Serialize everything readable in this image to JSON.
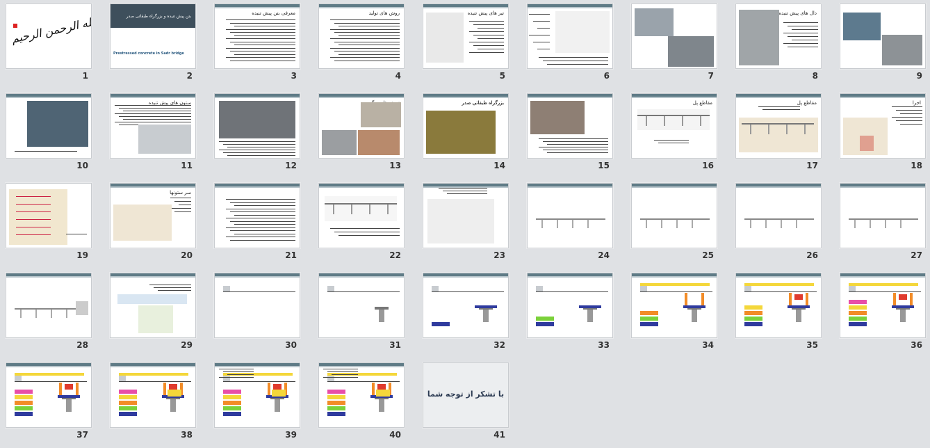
{
  "slides": [
    {
      "number": "1",
      "title": ""
    },
    {
      "number": "2",
      "title": "بتن پیش تنیده و بزرگراه طبقاتی صدر",
      "subtitle": "Prestressed concrete in Sadr bridge"
    },
    {
      "number": "3",
      "title": "معرفی بتن پیش تنیده"
    },
    {
      "number": "4",
      "title": "روش های تولید"
    },
    {
      "number": "5",
      "title": "تیر های پیش تنیده"
    },
    {
      "number": "6",
      "title": ""
    },
    {
      "number": "7",
      "title": ""
    },
    {
      "number": "8",
      "title": "دال های پیش تنیده"
    },
    {
      "number": "9",
      "title": ""
    },
    {
      "number": "10",
      "title": ""
    },
    {
      "number": "11",
      "title": "ستون های پیش تنیده"
    },
    {
      "number": "12",
      "title": ""
    },
    {
      "number": "13",
      "title": "نمونه های دیگر"
    },
    {
      "number": "14",
      "title": "بزرگراه طبقاتی صدر"
    },
    {
      "number": "15",
      "title": ""
    },
    {
      "number": "16",
      "title": "مقاطع پل"
    },
    {
      "number": "17",
      "title": "مقاطع پل"
    },
    {
      "number": "18",
      "title": "اجرا"
    },
    {
      "number": "19",
      "title": ""
    },
    {
      "number": "20",
      "title": "سر ستونها"
    },
    {
      "number": "21",
      "title": ""
    },
    {
      "number": "22",
      "title": ""
    },
    {
      "number": "23",
      "title": ""
    },
    {
      "number": "24",
      "title": ""
    },
    {
      "number": "25",
      "title": ""
    },
    {
      "number": "26",
      "title": ""
    },
    {
      "number": "27",
      "title": ""
    },
    {
      "number": "28",
      "title": ""
    },
    {
      "number": "29",
      "title": ""
    },
    {
      "number": "30",
      "title": ""
    },
    {
      "number": "31",
      "title": ""
    },
    {
      "number": "32",
      "title": ""
    },
    {
      "number": "33",
      "title": ""
    },
    {
      "number": "34",
      "title": ""
    },
    {
      "number": "35",
      "title": ""
    },
    {
      "number": "36",
      "title": ""
    },
    {
      "number": "37",
      "title": ""
    },
    {
      "number": "38",
      "title": ""
    },
    {
      "number": "39",
      "title": ""
    },
    {
      "number": "40",
      "title": ""
    },
    {
      "number": "41",
      "title": "با تشکر از توجه شما"
    }
  ],
  "colors": {
    "background": "#dfe1e4",
    "header_bar": "#5f7b86",
    "slide2_bg": "#3e4f5c",
    "accent_blue": "#2f3b9e",
    "accent_yellow": "#f4d73a",
    "accent_pink": "#e84ea8",
    "accent_orange": "#f28c28",
    "accent_red": "#e03b2e",
    "accent_green": "#7bd13a"
  }
}
